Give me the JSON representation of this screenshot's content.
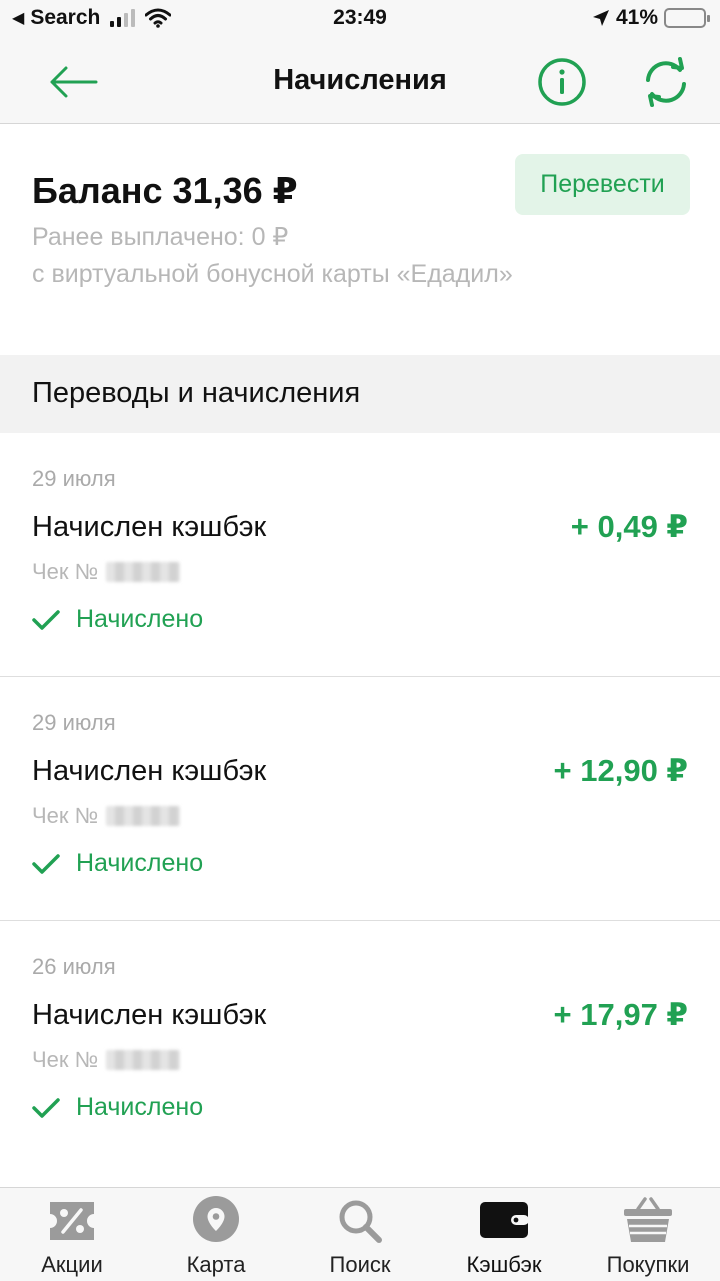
{
  "status_bar": {
    "back_label": "Search",
    "time": "23:49",
    "battery": "41%"
  },
  "nav": {
    "title": "Начисления"
  },
  "balance": {
    "title": "Баланс 31,36 ₽",
    "transfer_button": "Перевести",
    "paid_line": "Ранее выплачено: 0 ₽",
    "paid_source": "с виртуальной бонусной карты «Едадил»"
  },
  "section": {
    "title": "Переводы и начисления"
  },
  "transactions": [
    {
      "date": "29 июля",
      "title": "Начислен кэшбэк",
      "check_label": "Чек №",
      "amount": "+ 0,49 ₽",
      "status": "Начислено"
    },
    {
      "date": "29 июля",
      "title": "Начислен кэшбэк",
      "check_label": "Чек №",
      "amount": "+ 12,90 ₽",
      "status": "Начислено"
    },
    {
      "date": "26 июля",
      "title": "Начислен кэшбэк",
      "check_label": "Чек №",
      "amount": "+ 17,97 ₽",
      "status": "Начислено"
    }
  ],
  "tabs": [
    {
      "label": "Акции",
      "icon": "percent-ticket-icon",
      "active": false
    },
    {
      "label": "Карта",
      "icon": "map-pin-icon",
      "active": false
    },
    {
      "label": "Поиск",
      "icon": "search-icon",
      "active": false
    },
    {
      "label": "Кэшбэк",
      "icon": "wallet-icon",
      "active": true
    },
    {
      "label": "Покупки",
      "icon": "basket-icon",
      "active": false
    }
  ],
  "colors": {
    "accent": "#21a153",
    "button_bg": "#e3f4e8",
    "muted_text": "#b7b7b7",
    "tab_icon_inactive": "#9b9b9b",
    "tab_icon_active": "#111111"
  }
}
